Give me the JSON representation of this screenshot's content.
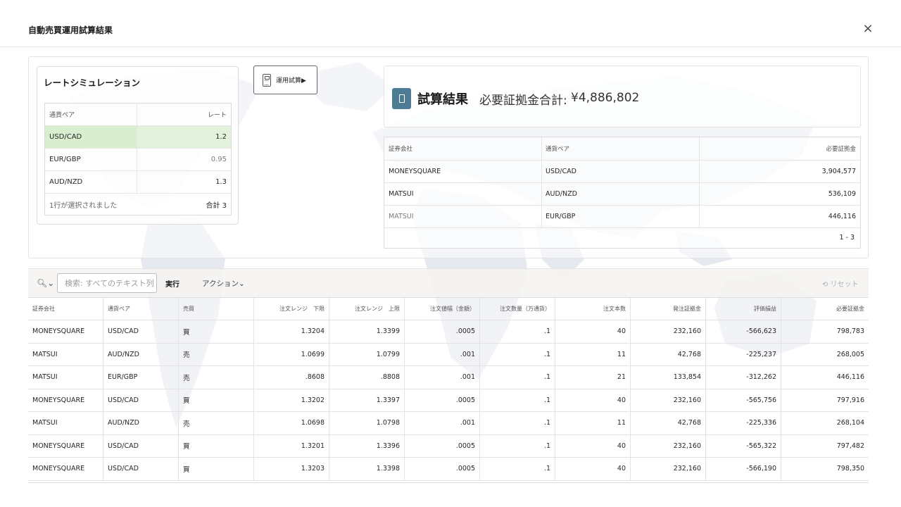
{
  "dialog": {
    "title": "自動売買運用試算結果",
    "close_label": "×"
  },
  "rate_sim": {
    "title": "レートシミュレーション",
    "headers": {
      "pair": "通貨ペア",
      "rate": "レート"
    },
    "rows": [
      {
        "pair": "USD/CAD",
        "rate": "1.2"
      },
      {
        "pair": "EUR/GBP",
        "rate": "0.95"
      },
      {
        "pair": "AUD/NZD",
        "rate": "1.3"
      }
    ],
    "footer_selected": "1行が選択されました",
    "footer_total": "合計 3"
  },
  "calc_button": {
    "label": "運用試算▶"
  },
  "result": {
    "title": "試算結果",
    "sum_label": "必要証拠金合計:",
    "sum_value": "¥4,886,802",
    "headers": {
      "broker": "証券会社",
      "pair": "通貨ペア",
      "margin": "必要証拠金"
    },
    "rows": [
      {
        "broker": "MONEYSQUARE",
        "pair": "USD/CAD",
        "margin": "3,904,577"
      },
      {
        "broker": "MATSUI",
        "pair": "AUD/NZD",
        "margin": "536,109"
      },
      {
        "broker": "MATSUI",
        "pair": "EUR/GBP",
        "margin": "446,116"
      }
    ],
    "pagination": "1 - 3"
  },
  "toolbar": {
    "search_placeholder": "検索: すべてのテキスト列",
    "go_label": "実行",
    "actions_label": "アクション⌄",
    "reset_label": "⟲ リセット"
  },
  "grid": {
    "headers": [
      "証券会社",
      "通貨ペア",
      "売買",
      "注文レンジ　下限",
      "注文レンジ　上限",
      "注文値幅（金額）",
      "注文数量（万通貨）",
      "注文本数",
      "発注証拠金",
      "評価損益",
      "必要証拠金"
    ],
    "rows": [
      [
        "MONEYSQUARE",
        "USD/CAD",
        "買",
        "1.3204",
        "1.3399",
        ".0005",
        ".1",
        "40",
        "232,160",
        "-566,623",
        "798,783"
      ],
      [
        "MATSUI",
        "AUD/NZD",
        "売",
        "1.0699",
        "1.0799",
        ".001",
        ".1",
        "11",
        "42,768",
        "-225,237",
        "268,005"
      ],
      [
        "MATSUI",
        "EUR/GBP",
        "売",
        ".8608",
        ".8808",
        ".001",
        ".1",
        "21",
        "133,854",
        "-312,262",
        "446,116"
      ],
      [
        "MONEYSQUARE",
        "USD/CAD",
        "買",
        "1.3202",
        "1.3397",
        ".0005",
        ".1",
        "40",
        "232,160",
        "-565,756",
        "797,916"
      ],
      [
        "MATSUI",
        "AUD/NZD",
        "売",
        "1.0698",
        "1.0798",
        ".001",
        ".1",
        "11",
        "42,768",
        "-225,336",
        "268,104"
      ],
      [
        "MONEYSQUARE",
        "USD/CAD",
        "買",
        "1.3201",
        "1.3396",
        ".0005",
        ".1",
        "40",
        "232,160",
        "-565,322",
        "797,482"
      ],
      [
        "MONEYSQUARE",
        "USD/CAD",
        "買",
        "1.3203",
        "1.3398",
        ".0005",
        ".1",
        "40",
        "232,160",
        "-566,190",
        "798,350"
      ]
    ]
  }
}
